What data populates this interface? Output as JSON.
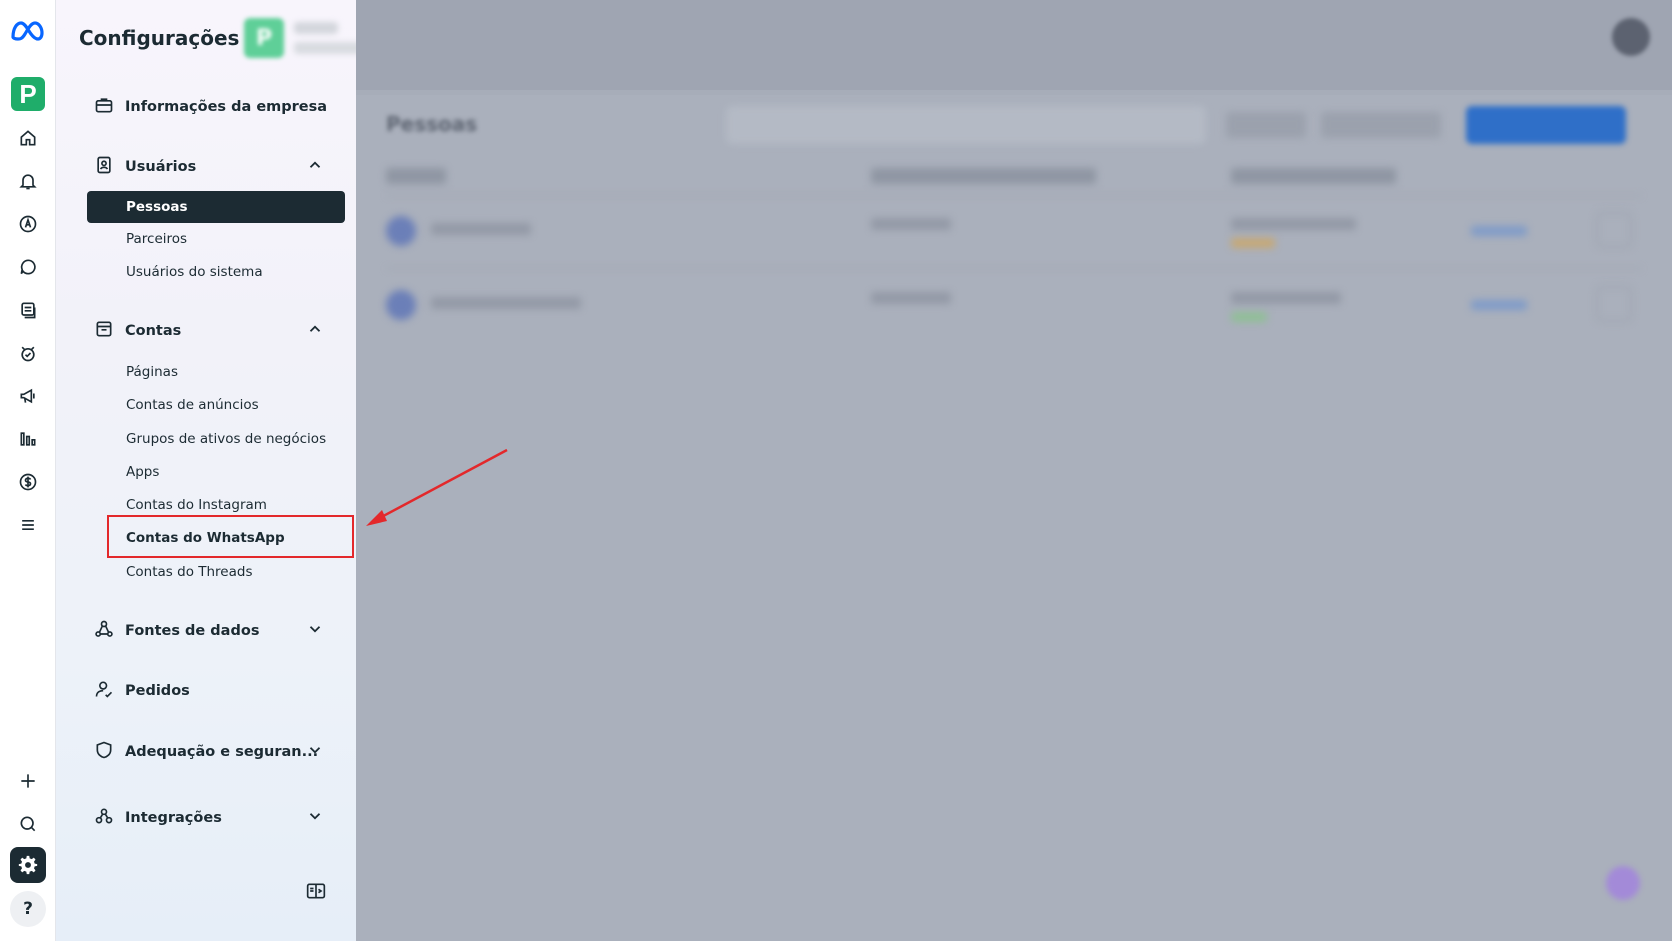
{
  "sidebar": {
    "title": "Configurações",
    "business_initial": "P",
    "company_info": "Informações da empresa",
    "users": {
      "label": "Usuários",
      "items": [
        "Pessoas",
        "Parceiros",
        "Usuários do sistema"
      ]
    },
    "accounts": {
      "label": "Contas",
      "items": [
        "Páginas",
        "Contas de anúncios",
        "Grupos de ativos de negócios",
        "Apps",
        "Contas do Instagram",
        "Contas do WhatsApp",
        "Contas do Threads"
      ]
    },
    "data_sources": "Fontes de dados",
    "orders": "Pedidos",
    "compliance": "Adequação e seguran...",
    "integrations": "Integrações"
  },
  "rail": {
    "business_initial": "P",
    "help_label": "?"
  },
  "main": {
    "title": "Pessoas"
  },
  "colors": {
    "accent_dark": "#1c2b33",
    "highlight_red": "#e3282b",
    "business_green": "#1fad6a"
  }
}
